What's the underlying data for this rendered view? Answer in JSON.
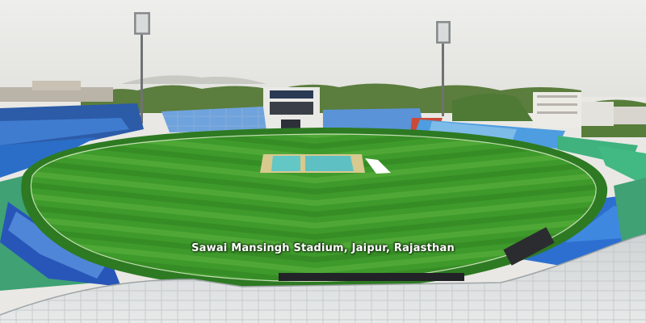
{
  "caption": "Sawai Mansingh Stadium, Jaipur, Rajasthan",
  "colors": {
    "sky": "#e9e8e4",
    "field_green": "#3f9a2c",
    "field_stripe_light": "#5cb43f",
    "field_stripe_dark": "#2f8420",
    "pitch_cover": "#5fc3c4",
    "pitch_soil": "#d8c98f",
    "stand_blue": "#3f82d6",
    "stand_deep_blue": "#1f4fa6",
    "stand_green": "#3fb27e",
    "roof": "#d9dbdc",
    "tree_green": "#4e7a36"
  },
  "scene_elements": [
    "sky",
    "floodlight-tower",
    "stadium-stands",
    "cricket-outfield",
    "pitch-cover",
    "canopy-roof",
    "trees",
    "buildings"
  ]
}
